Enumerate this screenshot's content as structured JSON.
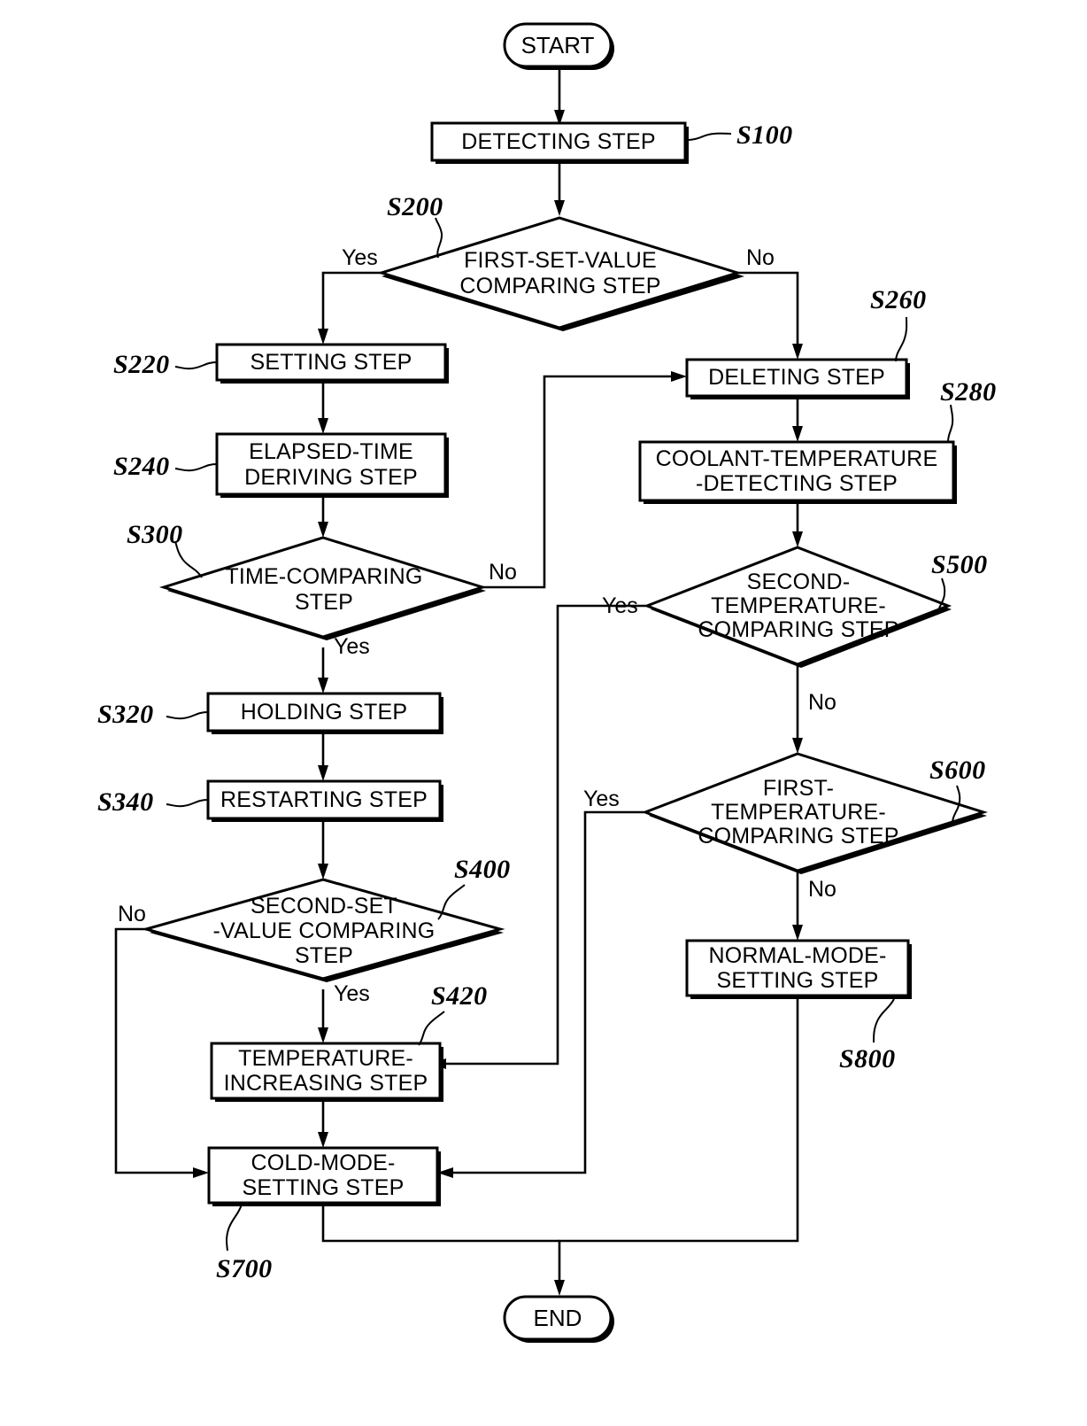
{
  "diagram": {
    "type": "flowchart",
    "title": "Engine cold-mode control method flowchart",
    "terminals": {
      "start": "START",
      "end": "END"
    },
    "nodes": [
      {
        "id": "S100",
        "ref": "S100",
        "shape": "process",
        "label_lines": [
          "DETECTING STEP"
        ]
      },
      {
        "id": "S200",
        "ref": "S200",
        "shape": "decision",
        "label_lines": [
          "FIRST-SET-VALUE",
          "COMPARING STEP"
        ]
      },
      {
        "id": "S220",
        "ref": "S220",
        "shape": "process",
        "label_lines": [
          "SETTING STEP"
        ]
      },
      {
        "id": "S240",
        "ref": "S240",
        "shape": "process",
        "label_lines": [
          "ELAPSED-TIME",
          "DERIVING STEP"
        ]
      },
      {
        "id": "S300",
        "ref": "S300",
        "shape": "decision",
        "label_lines": [
          "TIME-COMPARING",
          "STEP"
        ]
      },
      {
        "id": "S320",
        "ref": "S320",
        "shape": "process",
        "label_lines": [
          "HOLDING STEP"
        ]
      },
      {
        "id": "S340",
        "ref": "S340",
        "shape": "process",
        "label_lines": [
          "RESTARTING STEP"
        ]
      },
      {
        "id": "S400",
        "ref": "S400",
        "shape": "decision",
        "label_lines": [
          "SECOND-SET",
          "-VALUE COMPARING",
          "STEP"
        ]
      },
      {
        "id": "S420",
        "ref": "S420",
        "shape": "process",
        "label_lines": [
          "TEMPERATURE-",
          "INCREASING STEP"
        ]
      },
      {
        "id": "S700",
        "ref": "S700",
        "shape": "process",
        "label_lines": [
          "COLD-MODE-",
          "SETTING STEP"
        ]
      },
      {
        "id": "S260",
        "ref": "S260",
        "shape": "process",
        "label_lines": [
          "DELETING STEP"
        ]
      },
      {
        "id": "S280",
        "ref": "S280",
        "shape": "process",
        "label_lines": [
          "COOLANT-TEMPERATURE",
          "-DETECTING STEP"
        ]
      },
      {
        "id": "S500",
        "ref": "S500",
        "shape": "decision",
        "label_lines": [
          "SECOND-",
          "TEMPERATURE-",
          "COMPARING STEP"
        ]
      },
      {
        "id": "S600",
        "ref": "S600",
        "shape": "decision",
        "label_lines": [
          "FIRST-",
          "TEMPERATURE-",
          "COMPARING STEP"
        ]
      },
      {
        "id": "S800",
        "ref": "S800",
        "shape": "process",
        "label_lines": [
          "NORMAL-MODE-",
          "SETTING STEP"
        ]
      }
    ],
    "edge_labels": {
      "s200_yes": "Yes",
      "s200_no": "No",
      "s300_no": "No",
      "s300_yes": "Yes",
      "s400_no": "No",
      "s400_yes": "Yes",
      "s500_yes": "Yes",
      "s500_no": "No",
      "s600_yes": "Yes",
      "s600_no": "No"
    },
    "colors": {
      "stroke": "#000000",
      "fill": "#ffffff"
    }
  }
}
